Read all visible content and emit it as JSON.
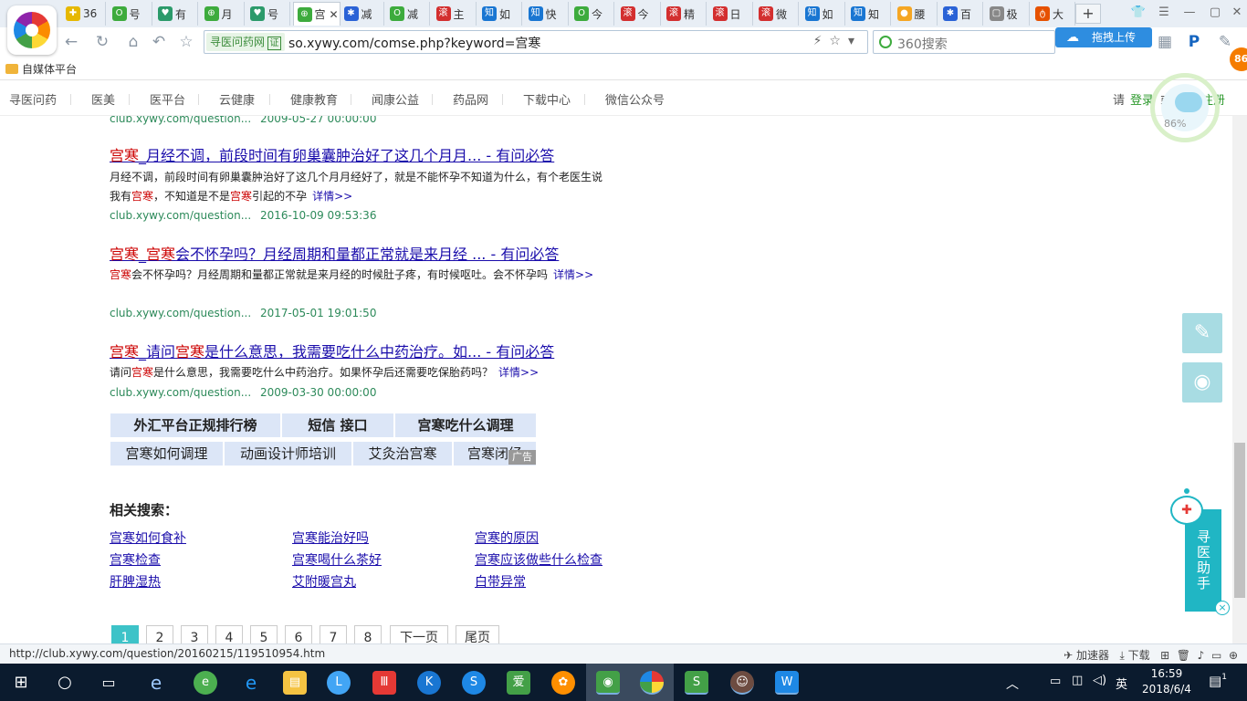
{
  "browser": {
    "tabs": [
      {
        "label": "36",
        "color": "#e6b800",
        "glyph": "✚"
      },
      {
        "label": "号",
        "color": "#3dab3d",
        "glyph": "O"
      },
      {
        "label": "有",
        "color": "#2b9a6a",
        "glyph": "♥"
      },
      {
        "label": "月",
        "color": "#3dab3d",
        "glyph": "⊕"
      },
      {
        "label": "号",
        "color": "#2b9a6a",
        "glyph": "♥"
      },
      {
        "label": "宫",
        "color": "#3dab3d",
        "glyph": "⊕"
      },
      {
        "label": "减",
        "color": "#2a62d6",
        "glyph": "✱"
      },
      {
        "label": "减",
        "color": "#3dab3d",
        "glyph": "O"
      },
      {
        "label": "主",
        "color": "#d32f2f",
        "glyph": "滚"
      },
      {
        "label": "如",
        "color": "#1976d2",
        "glyph": "知"
      },
      {
        "label": "快",
        "color": "#1976d2",
        "glyph": "知"
      },
      {
        "label": "今",
        "color": "#3dab3d",
        "glyph": "O"
      },
      {
        "label": "今",
        "color": "#d32f2f",
        "glyph": "滚"
      },
      {
        "label": "精",
        "color": "#d32f2f",
        "glyph": "滚"
      },
      {
        "label": "日",
        "color": "#d32f2f",
        "glyph": "滚"
      },
      {
        "label": "微",
        "color": "#d32f2f",
        "glyph": "滚"
      },
      {
        "label": "如",
        "color": "#1976d2",
        "glyph": "知"
      },
      {
        "label": "知",
        "color": "#1976d2",
        "glyph": "知"
      },
      {
        "label": "腰",
        "color": "#f5a623",
        "glyph": "●"
      },
      {
        "label": "百",
        "color": "#2a62d6",
        "glyph": "✱"
      },
      {
        "label": "极",
        "color": "#888888",
        "glyph": "▢"
      },
      {
        "label": "大",
        "color": "#e65100",
        "glyph": "ტ"
      }
    ],
    "active_tab_index": 5,
    "new_tab": "+",
    "address": {
      "site_badge": "寻医问药网",
      "cert": "证",
      "url": "so.xywy.com/comse.php?keyword=宫寒"
    },
    "search_placeholder": "360搜索",
    "upload_button": "拖拽上传",
    "bookmark": "自媒体平台",
    "badge_count": "86",
    "status_url": "http://club.xywy.com/question/20160215/119510954.htm",
    "status_items": [
      "加速器",
      "下载"
    ]
  },
  "sitenav": {
    "items": [
      "寻医问药",
      "医美",
      "医平台",
      "云健康",
      "健康教育",
      "闻康公益",
      "药品网",
      "下载中心",
      "微信公众号"
    ],
    "login_prefix": "请",
    "login": "登录",
    "or": "或",
    "register": "免费注册",
    "widget_percent": "86%"
  },
  "results": [
    {
      "url": "club.xywy.com/question...",
      "date": "2009-05-27 00:00:00"
    },
    {
      "title_parts": [
        {
          "t": "宫寒",
          "h": true
        },
        {
          "t": "_月经不调，前段时间有卵巢囊肿治好了这几个月月... - 有问必答",
          "h": false
        }
      ],
      "desc_parts": [
        {
          "t": "月经不调，前段时间有卵巢囊肿治好了这几个月月经好了，就是不能怀孕不知道为什么，有个老医生说我有",
          "h": false
        },
        {
          "t": "宫寒",
          "h": true
        },
        {
          "t": "，不知道是不是",
          "h": false
        },
        {
          "t": "宫寒",
          "h": true
        },
        {
          "t": "引起的不孕",
          "h": false
        }
      ],
      "more": "详情>>",
      "url": "club.xywy.com/question...",
      "date": "2016-10-09 09:53:36"
    },
    {
      "title_parts": [
        {
          "t": "宫寒",
          "h": true
        },
        {
          "t": "_",
          "h": false
        },
        {
          "t": "宫寒",
          "h": true
        },
        {
          "t": "会不怀孕吗？月经周期和量都正常就是来月经 ... - 有问必答",
          "h": false
        }
      ],
      "desc_parts": [
        {
          "t": "宫寒",
          "h": true
        },
        {
          "t": "会不怀孕吗？月经周期和量都正常就是来月经的时候肚子疼，有时候呕吐。会不怀孕吗",
          "h": false
        }
      ],
      "more": "详情>>",
      "url": "club.xywy.com/question...",
      "date": "2017-05-01 19:01:50"
    },
    {
      "title_parts": [
        {
          "t": "宫寒",
          "h": true
        },
        {
          "t": "_请问",
          "h": false
        },
        {
          "t": "宫寒",
          "h": true
        },
        {
          "t": "是什么意思，我需要吃什么中药治疗。如... - 有问必答",
          "h": false
        }
      ],
      "desc_parts": [
        {
          "t": "请问",
          "h": false
        },
        {
          "t": "宫寒",
          "h": true
        },
        {
          "t": "是什么意思，我需要吃什么中药治疗。如果怀孕后还需要吃保胎药吗？",
          "h": false
        }
      ],
      "more": "详情>>",
      "url": "club.xywy.com/question...",
      "date": "2009-03-30 00:00:00"
    }
  ],
  "ads": {
    "row1": [
      "外汇平台正规排行榜",
      "短信 接口",
      "宫寒吃什么调理"
    ],
    "row2": [
      "宫寒如何调理",
      "动画设计师培训",
      "艾灸治宫寒",
      "宫寒闭经"
    ],
    "label": "广告"
  },
  "related": {
    "heading": "相关搜索：",
    "links": [
      "宫寒如何食补",
      "宫寒能治好吗",
      "宫寒的原因",
      "宫寒检查",
      "宫寒喝什么茶好",
      "宫寒应该做些什么检查",
      "肝脾湿热",
      "艾附暖宫丸",
      "白带异常"
    ]
  },
  "pagination": [
    "1",
    "2",
    "3",
    "4",
    "5",
    "6",
    "7",
    "8",
    "下一页",
    "尾页"
  ],
  "assistant": {
    "label": "寻医助手",
    "close": "×"
  },
  "taskbar": {
    "time": "16:59",
    "date": "2018/6/4",
    "ime": "英",
    "notif_count": "1"
  }
}
